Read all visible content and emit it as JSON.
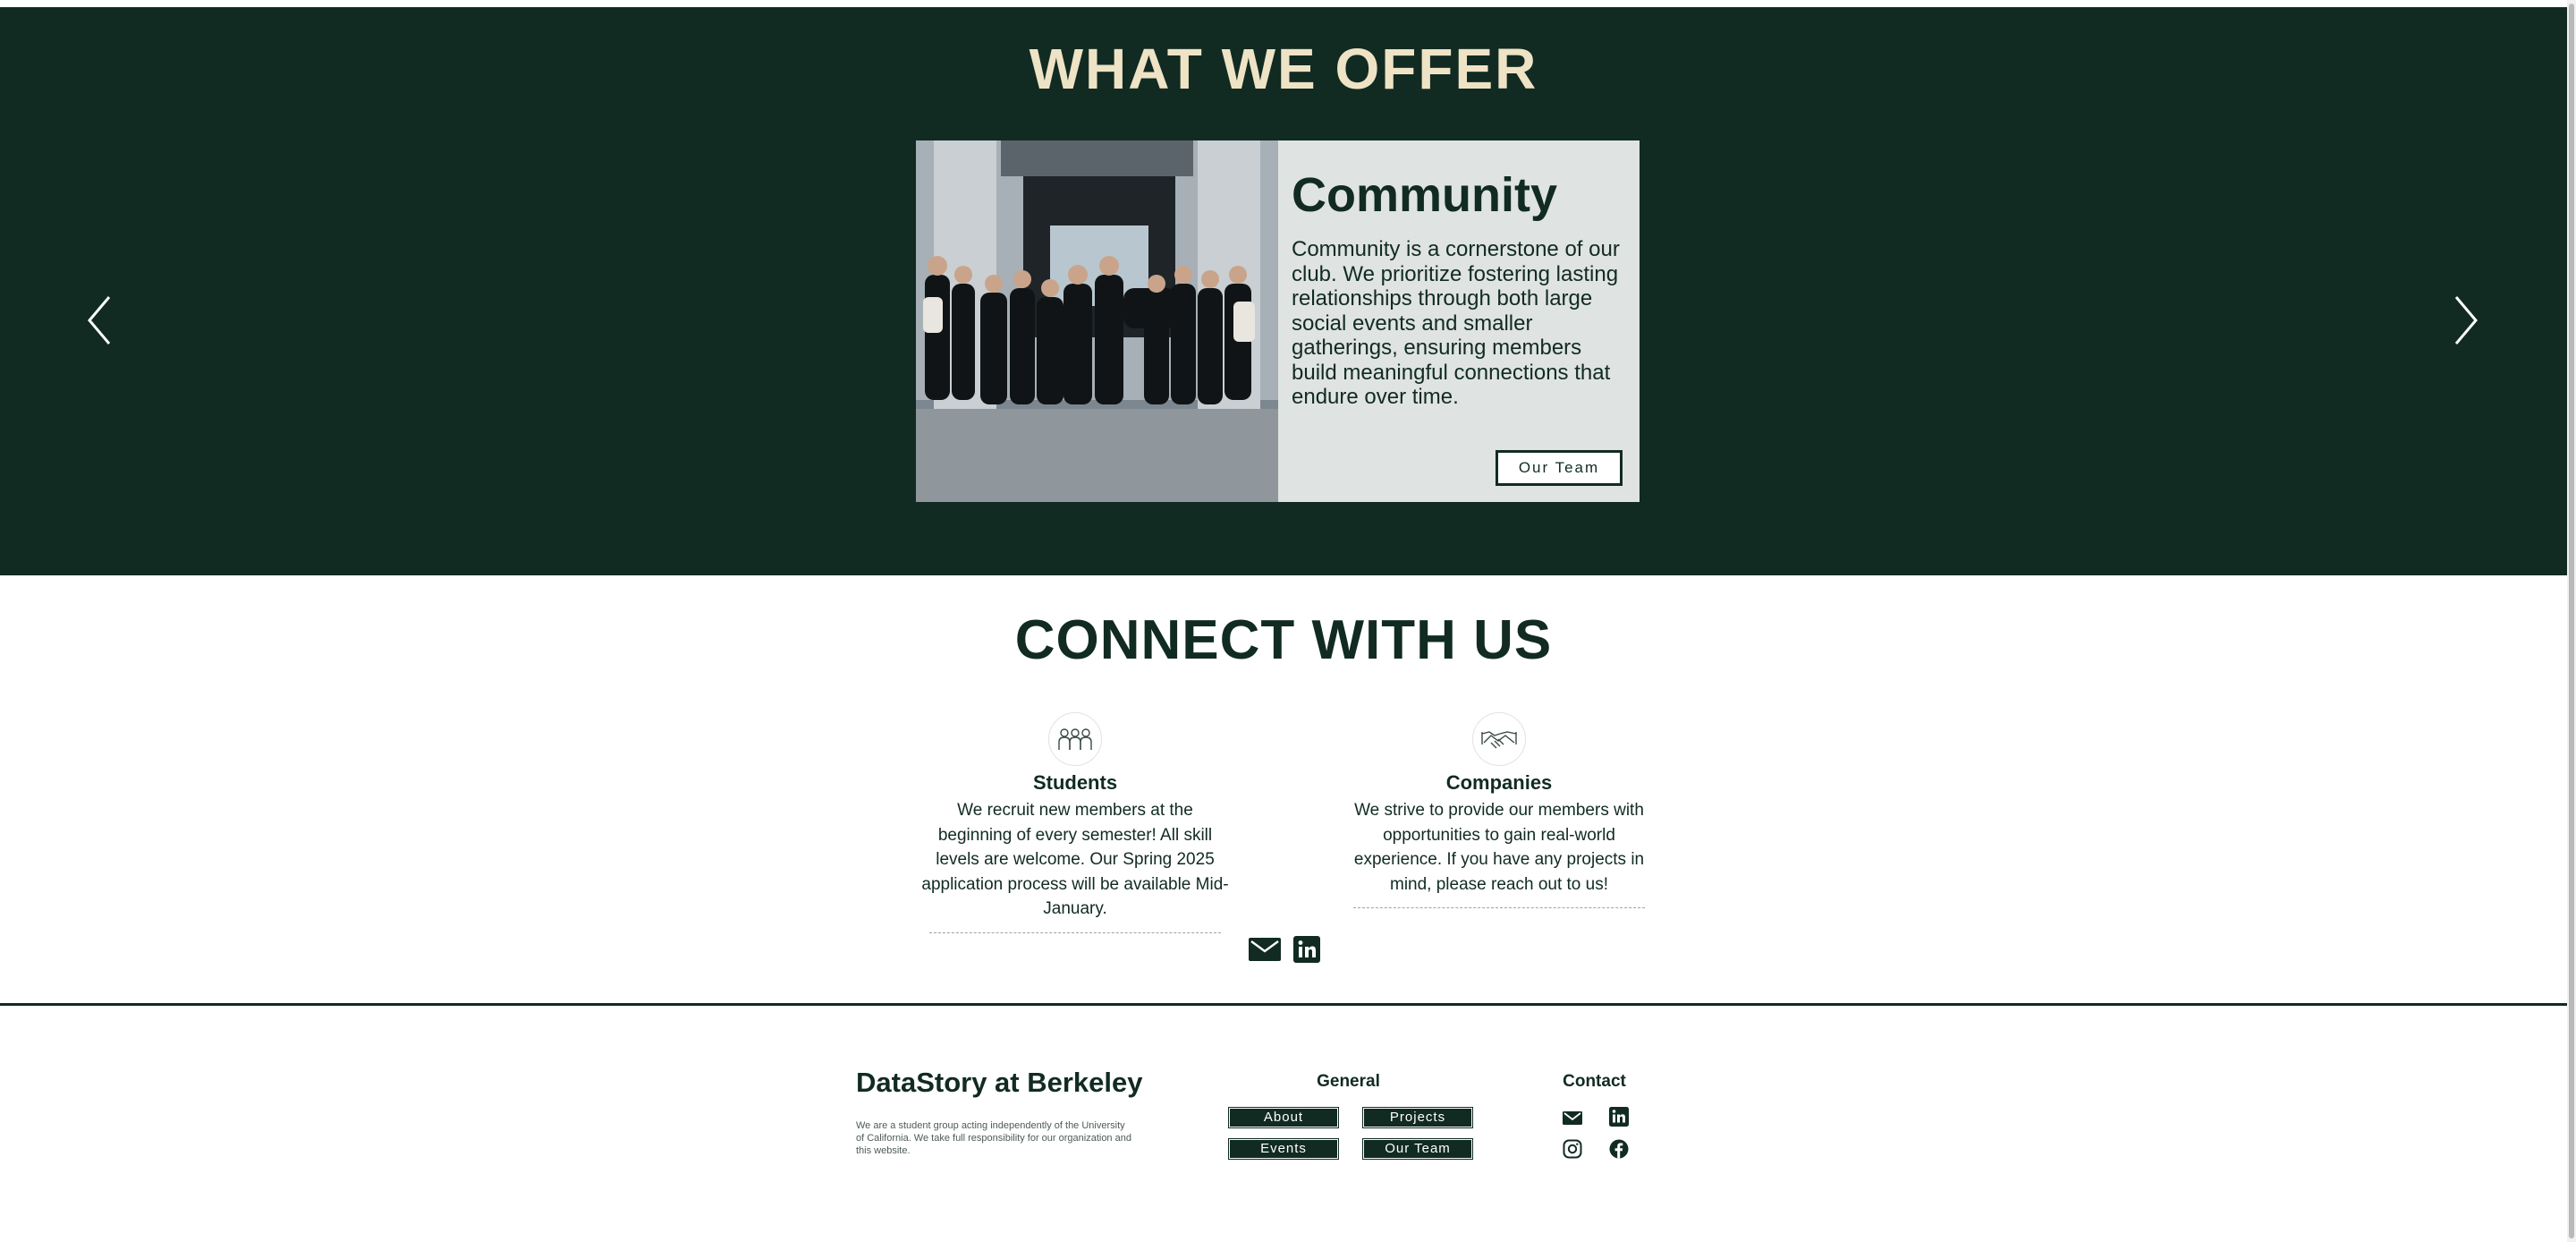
{
  "offer": {
    "title": "WHAT WE OFFER",
    "slide": {
      "heading": "Community",
      "body": "Community is a cornerstone of our club. We prioritize fostering lasting relationships through both large social events and smaller gatherings, ensuring members build meaningful connections that endure over time.",
      "button_label": "Our Team"
    }
  },
  "connect": {
    "title": "CONNECT WITH US",
    "students": {
      "title": "Students",
      "text": "We recruit new members at the beginning of every semester! All skill levels are welcome. Our Spring 2025 application process will be available Mid-January."
    },
    "companies": {
      "title": "Companies",
      "text": "We strive to provide our members with opportunities to gain real-world experience. If you have any projects in mind, please reach out to us!"
    }
  },
  "footer": {
    "brand": "DataStory at Berkeley",
    "disclaimer": "We are a student group acting independently of the University of California. We take full responsibility for our organization and this website.",
    "general": {
      "title": "General",
      "links": [
        "About",
        "Projects",
        "Events",
        "Our Team"
      ]
    },
    "contact": {
      "title": "Contact"
    }
  },
  "colors": {
    "dark_green": "#112b22",
    "cream": "#efe3c6",
    "card_bg": "#dfe3e1"
  },
  "icons": [
    "chevron-left-icon",
    "chevron-right-icon",
    "people-icon",
    "handshake-icon",
    "mail-icon",
    "linkedin-icon",
    "instagram-icon",
    "facebook-icon"
  ]
}
